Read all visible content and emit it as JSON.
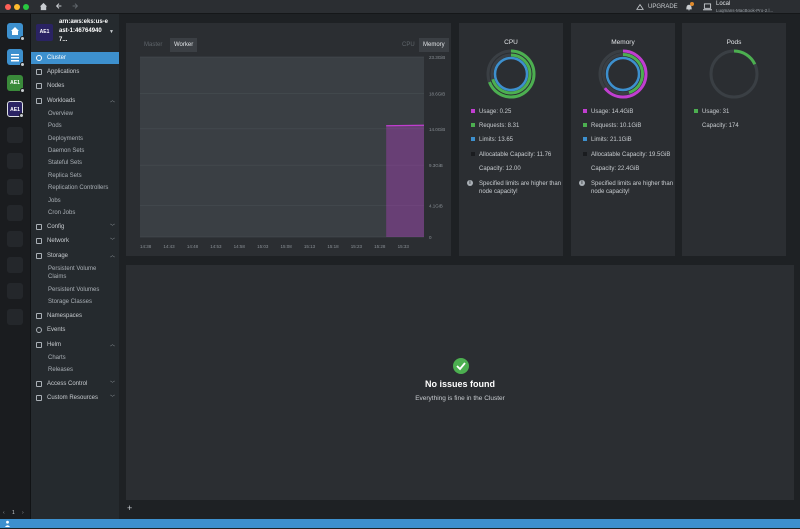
{
  "titlebar": {
    "upgrade_label": "UPGRADE",
    "local_title": "Local",
    "local_subtitle": "Luqmans-MacBook-Pro-2.l..."
  },
  "hotbar": {
    "items": [
      {
        "label": "",
        "icon": "home-icon"
      },
      {
        "label": "",
        "icon": "catalog-icon"
      },
      {
        "label": "AE1",
        "color": "#3a8a3a"
      },
      {
        "label": "AE1",
        "color": "#2a2363"
      }
    ],
    "footer_page": "1"
  },
  "cluster": {
    "avatar": "AE1",
    "name": "arn:aws:eks:us-east-1:467649407..."
  },
  "nav": {
    "cluster": "Cluster",
    "applications": "Applications",
    "nodes": "Nodes",
    "workloads": "Workloads",
    "workloads_items": [
      "Overview",
      "Pods",
      "Deployments",
      "Daemon Sets",
      "Stateful Sets",
      "Replica Sets",
      "Replication Controllers",
      "Jobs",
      "Cron Jobs"
    ],
    "config": "Config",
    "network": "Network",
    "storage": "Storage",
    "storage_items": [
      "Persistent Volume Claims",
      "Persistent Volumes",
      "Storage Classes"
    ],
    "namespaces": "Namespaces",
    "events": "Events",
    "helm": "Helm",
    "helm_items": [
      "Charts",
      "Releases"
    ],
    "access_control": "Access Control",
    "custom_resources": "Custom Resources"
  },
  "chart_panel": {
    "tabs_left": [
      "Master",
      "Worker"
    ],
    "active_left": "Worker",
    "tabs_right": [
      "CPU",
      "Memory"
    ],
    "active_right": "Memory"
  },
  "chart_data": {
    "type": "area",
    "x": [
      "14:38",
      "14:43",
      "14:48",
      "14:53",
      "14:58",
      "15:03",
      "15:08",
      "15:13",
      "15:18",
      "15:23",
      "15:28",
      "15:33"
    ],
    "y_ticks": [
      "0",
      "4.1GiB",
      "9.3GiB",
      "14.0GiB",
      "18.6GiB",
      "23.3GiB"
    ],
    "ylim": [
      0,
      23.3
    ],
    "series": [
      {
        "values": [
          null,
          null,
          null,
          null,
          null,
          null,
          null,
          null,
          null,
          null,
          14.4,
          14.4
        ],
        "color": "#c13ed0"
      }
    ],
    "grid": true
  },
  "metrics": {
    "cpu": {
      "title": "CPU",
      "usage": "Usage: 0.25",
      "requests": "Requests: 8.31",
      "limits": "Limits: 13.65",
      "allocatable": "Allocatable Capacity: 11.76",
      "capacity": "Capacity: 12.00",
      "warning": "Specified limits are higher than node capacity!"
    },
    "memory": {
      "title": "Memory",
      "usage": "Usage: 14.4GiB",
      "requests": "Requests: 10.1GiB",
      "limits": "Limits: 21.1GiB",
      "allocatable": "Allocatable Capacity: 19.5GiB",
      "capacity": "Capacity: 22.4GiB",
      "warning": "Specified limits are higher than node capacity!"
    },
    "pods": {
      "title": "Pods",
      "usage": "Usage: 31",
      "capacity": "Capacity: 174"
    }
  },
  "colors": {
    "usage": "#c13ed0",
    "requests": "#4caf50",
    "limits": "#3d90ce",
    "allocatable": "#1a1c1f",
    "capacity": "#2b2e32",
    "accent": "#3d90ce"
  },
  "issues": {
    "title": "No issues found",
    "subtitle": "Everything is fine in the Cluster"
  },
  "footer": {
    "add_label": "+"
  }
}
